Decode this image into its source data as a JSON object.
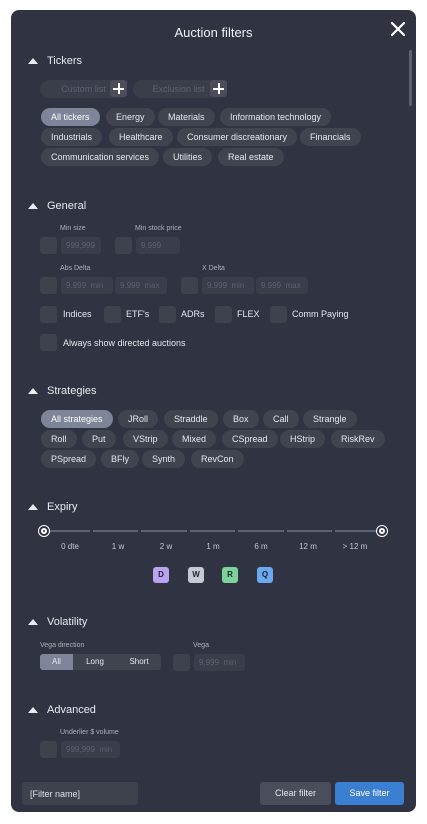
{
  "title": "Auction filters",
  "icons": {
    "close": "close-icon",
    "collapse": "triangle-up-icon",
    "add": "plus-icon"
  },
  "tickers": {
    "header": "Tickers",
    "custom_list": "Custom list",
    "exclusion_list": "Exclusion list",
    "items": [
      "All tickers",
      "Energy",
      "Materials",
      "Information technology",
      "Industrials",
      "Healthcare",
      "Consumer discreationary",
      "Financials",
      "Communication services",
      "Utilities",
      "Real estate"
    ],
    "selected": "All tickers"
  },
  "general": {
    "header": "General",
    "min_size_label": "Min size",
    "min_size_placeholder": "999,999",
    "min_stock_price_label": "Min stock price",
    "min_stock_price_placeholder": "9,999",
    "abs_delta_label": "Abs Delta",
    "abs_delta_min_placeholder": "9.999  min",
    "abs_delta_max_placeholder": "9.999  max",
    "x_delta_label": "X Delta",
    "x_delta_min_placeholder": "9.999  min",
    "x_delta_max_placeholder": "9.999  max",
    "checkboxes": [
      "Indices",
      "ETF's",
      "ADRs",
      "FLEX",
      "Comm Paying"
    ],
    "always_show": "Always show directed auctions"
  },
  "strategies": {
    "header": "Strategies",
    "items": [
      "All strategies",
      "JRoll",
      "Straddle",
      "Box",
      "Call",
      "Strangle",
      "Roll",
      "Put",
      "VStrip",
      "Mixed",
      "CSpread",
      "HStrip",
      "RiskRev",
      "PSpread",
      "BFly",
      "Synth",
      "RevCon"
    ],
    "selected": "All strategies"
  },
  "expiry": {
    "header": "Expiry",
    "ticks": [
      "0 dte",
      "1 w",
      "2 w",
      "1 m",
      "6 m",
      "12 m",
      "> 12 m"
    ],
    "range": [
      "0 dte",
      "> 12 m"
    ],
    "badges": [
      {
        "label": "D",
        "color": "#b9a3ef"
      },
      {
        "label": "W",
        "color": "#c5c9d3"
      },
      {
        "label": "R",
        "color": "#7ed39b"
      },
      {
        "label": "Q",
        "color": "#6aa8f0"
      }
    ]
  },
  "volatility": {
    "header": "Volatility",
    "vega_direction_label": "Vega direction",
    "directions": [
      "All",
      "Long",
      "Short"
    ],
    "selected": "All",
    "vega_label": "Vega",
    "vega_placeholder": "9,999  min"
  },
  "advanced": {
    "header": "Advanced",
    "underlier_label": "Underlier $ volume",
    "underlier_placeholder": "999,999  min"
  },
  "footer": {
    "filter_name_placeholder": "[Filter name]",
    "clear": "Clear filter",
    "save": "Save filter"
  },
  "colors": {
    "panel": "#2f3342",
    "pill": "#40444f",
    "pill_active": "#7e8599",
    "save": "#3b7fd2"
  }
}
